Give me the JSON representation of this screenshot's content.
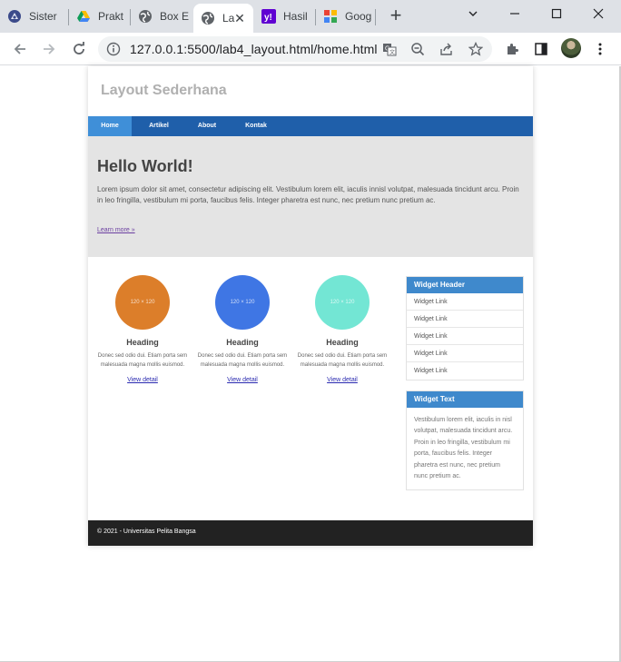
{
  "browser": {
    "tabs": [
      {
        "title": "Sister"
      },
      {
        "title": "Prakt"
      },
      {
        "title": "Box E"
      },
      {
        "title": "La"
      },
      {
        "title": "Hasil"
      },
      {
        "title": "Goog"
      }
    ],
    "url": "127.0.0.1:5500/lab4_layout.html/home.html"
  },
  "site": {
    "title": "Layout Sederhana",
    "nav": [
      {
        "label": "Home"
      },
      {
        "label": "Artikel"
      },
      {
        "label": "About"
      },
      {
        "label": "Kontak"
      }
    ],
    "hero": {
      "heading": "Hello World!",
      "text": "Lorem ipsum dolor sit amet, consectetur adipiscing elit. Vestibulum lorem elit, iaculis innisl volutpat, malesuada tincidunt arcu. Proin in leo fringilla, vestibulum mi porta, faucibus felis. Integer pharetra est nunc, nec pretium nunc pretium ac.",
      "link": "Learn more »"
    },
    "cards": [
      {
        "placeholder": "120 × 120",
        "color": "#dc7e2a",
        "heading": "Heading",
        "text": "Donec sed odio dui. Etiam porta sem malesuada magna mollis euismod.",
        "link": "View detail"
      },
      {
        "placeholder": "120 × 120",
        "color": "#3f76e4",
        "heading": "Heading",
        "text": "Donec sed odio dui. Etiam porta sem malesuada magna mollis euismod.",
        "link": "View detail"
      },
      {
        "placeholder": "120 × 120",
        "color": "#73e6d4",
        "heading": "Heading",
        "text": "Donec sed odio dui. Etiam porta sem malesuada magna mollis euismod.",
        "link": "View detail"
      }
    ],
    "widget_links": {
      "header": "Widget Header",
      "links": [
        "Widget Link",
        "Widget Link",
        "Widget Link",
        "Widget Link",
        "Widget Link"
      ]
    },
    "widget_text": {
      "header": "Widget Text",
      "text": "Vestibulum lorem elit, iaculis in nisl volutpat, malesuada tincidunt arcu. Proin in leo fringilla, vestibulum mi porta, faucibus felis. Integer pharetra est nunc, nec pretium nunc pretium ac."
    },
    "footer": "© 2021 - Universitas Pelita Bangsa"
  },
  "colors": {
    "nav_bar": "#1f5faa",
    "nav_active": "#3f8fd8",
    "widget_header": "#3f89cc",
    "footer": "#222222"
  }
}
